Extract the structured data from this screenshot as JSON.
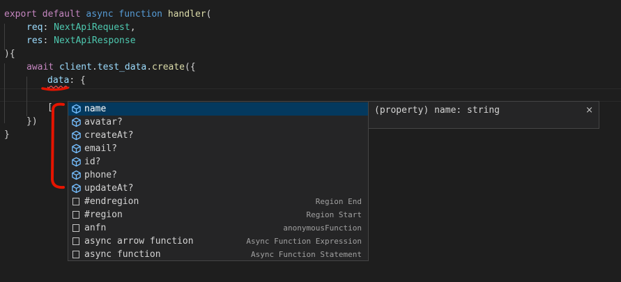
{
  "code": {
    "line1": {
      "kw1": "export",
      "kw2": "default",
      "kw3": "async",
      "kw4": "function",
      "fn": "handler",
      "punc": "("
    },
    "line2": {
      "var": "req",
      "punc": ": ",
      "type": "NextApiRequest",
      "punc2": ","
    },
    "line3": {
      "var": "res",
      "punc": ": ",
      "type": "NextApiResponse"
    },
    "line4": {
      "text": "){"
    },
    "line5": {
      "kw": "await",
      "obj": "client",
      "dot1": ".",
      "prop1": "test_data",
      "dot2": ".",
      "method": "create",
      "punc": "({"
    },
    "line6": {
      "var": "data",
      "punc": ": {"
    },
    "line8": {
      "text": "["
    },
    "line9": {
      "text": "})"
    },
    "line10": {
      "text": "}"
    }
  },
  "suggestions": [
    {
      "label": "name",
      "kind": "property-icon",
      "detail": ""
    },
    {
      "label": "avatar?",
      "kind": "property-icon",
      "detail": ""
    },
    {
      "label": "createAt?",
      "kind": "property-icon",
      "detail": ""
    },
    {
      "label": "email?",
      "kind": "property-icon",
      "detail": ""
    },
    {
      "label": "id?",
      "kind": "property-icon",
      "detail": ""
    },
    {
      "label": "phone?",
      "kind": "property-icon",
      "detail": ""
    },
    {
      "label": "updateAt?",
      "kind": "property-icon",
      "detail": ""
    },
    {
      "label": "#endregion",
      "kind": "snippet-icon",
      "detail": "Region End"
    },
    {
      "label": "#region",
      "kind": "snippet-icon",
      "detail": "Region Start"
    },
    {
      "label": "anfn",
      "kind": "snippet-icon",
      "detail": "anonymousFunction"
    },
    {
      "label": "async arrow function",
      "kind": "snippet-icon",
      "detail": "Async Function Expression"
    },
    {
      "label": "async function",
      "kind": "snippet-icon",
      "detail": "Async Function Statement"
    }
  ],
  "details": {
    "text": "(property) name: string",
    "close": "×"
  },
  "colors": {
    "background": "#1e1e1e",
    "keyword": "#569cd6",
    "control_keyword": "#c586c0",
    "function": "#dcdcaa",
    "variable": "#9cdcfe",
    "type": "#4ec9b0",
    "selection": "#04395e",
    "property_icon": "#75beff",
    "annotation": "#e51400"
  }
}
